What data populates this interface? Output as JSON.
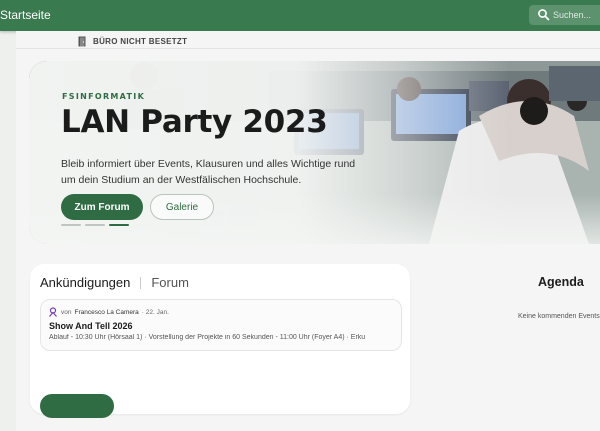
{
  "header": {
    "brand": "Startseite",
    "search_placeholder": "Suchen...",
    "color": "#3a7a4f"
  },
  "office_status": {
    "icon": "door-icon",
    "label": "BÜRO NICHT BESETZT"
  },
  "hero": {
    "eyebrow": "FSINFORMATIK",
    "title": "LAN Party 2023",
    "description": "Bleib informiert über Events, Klausuren und alles Wichtige rund um dein Studium an der Westfälischen Hochschule.",
    "primary_button": "Zum Forum",
    "secondary_button": "Galerie",
    "slides": 3,
    "active_slide": 3,
    "accent": "#2f6b43"
  },
  "announcements": {
    "tabs": [
      "Ankündigungen",
      "Forum"
    ],
    "active_tab": "Ankündigungen",
    "posts": [
      {
        "icon": "user-avatar-icon",
        "by": "von",
        "author": "Francesco La Camera",
        "date": "· 22. Jan.",
        "title": "Show And Tell 2026",
        "excerpt": "Ablauf - 10:30 Uhr (Hörsaal 1) · Vorstellung der Projekte in 60 Sekunden - 11:00 Uhr (Foyer A4) · Erku"
      }
    ]
  },
  "agenda": {
    "title": "Agenda",
    "empty_text": "Keine kommenden Events"
  }
}
